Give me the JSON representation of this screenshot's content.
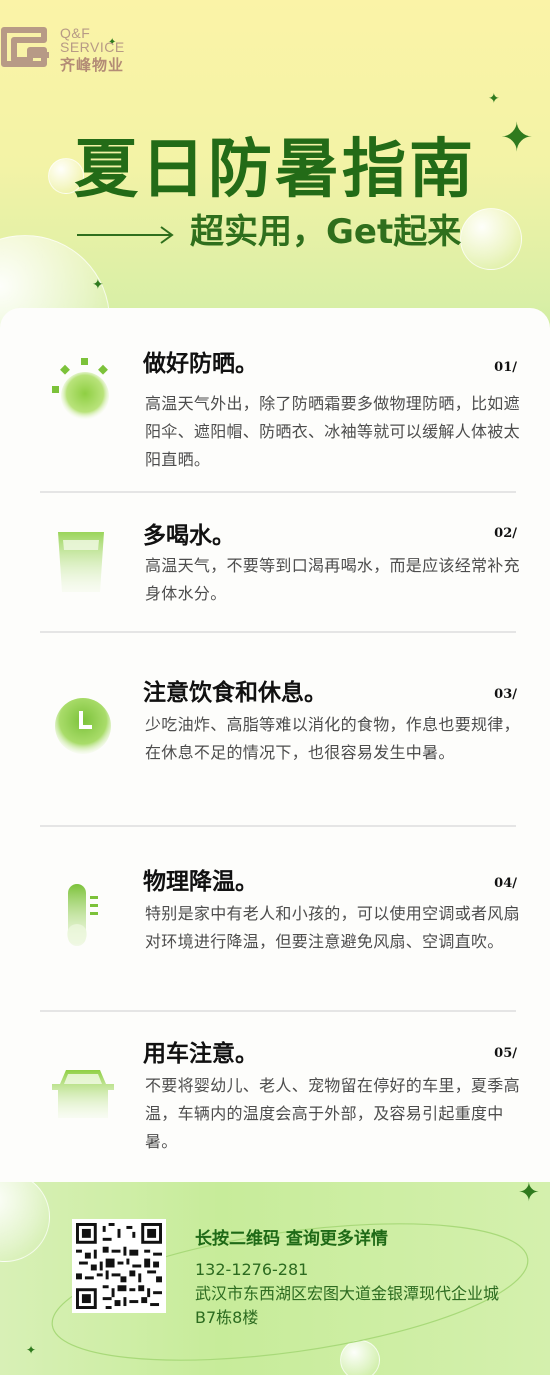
{
  "logo": {
    "en_line1": "Q&F",
    "en_line2": "SERVICE",
    "cn": "齐峰物业"
  },
  "header": {
    "title": "夏日防暑指南",
    "subtitle": "超实用，Get起来"
  },
  "tips": [
    {
      "icon": "sun-icon",
      "title": "做好防晒。",
      "num": "01/",
      "desc": "高温天气外出，除了防晒霜要多做物理防晒，比如遮阳伞、遮阳帽、防晒衣、冰袖等就可以缓解人体被太阳直晒。"
    },
    {
      "icon": "water-glass-icon",
      "title": "多喝水。",
      "num": "02/",
      "desc": "高温天气，不要等到口渴再喝水，而是应该经常补充身体水分。"
    },
    {
      "icon": "clock-icon",
      "title": "注意饮食和休息。",
      "num": "03/",
      "desc": "少吃油炸、高脂等难以消化的食物，作息也要规律，在休息不足的情况下，也很容易发生中暑。"
    },
    {
      "icon": "thermometer-icon",
      "title": "物理降温。",
      "num": "04/",
      "desc": "特别是家中有老人和小孩的，可以使用空调或者风扇对环境进行降温，但要注意避免风扇、空调直吹。"
    },
    {
      "icon": "car-icon",
      "title": "用车注意。",
      "num": "05/",
      "desc": "不要将婴幼儿、老人、宠物留在停好的车里，夏季高温，车辆内的温度会高于外部，及容易引起重度中暑。"
    }
  ],
  "footer": {
    "qr_icon": "qr-code-icon",
    "heading": "长按二维码 查询更多详情",
    "phone": "132-1276-281",
    "address": "武汉市东西湖区宏图大道金银潭现代企业城B7栋8楼"
  },
  "colors": {
    "primary_green": "#236b17",
    "light_green": "#9ad45a",
    "logo_brown": "#b79a86"
  }
}
